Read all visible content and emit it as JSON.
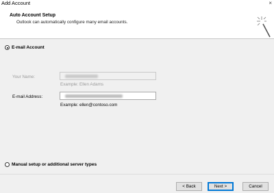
{
  "window": {
    "title": "Add Account",
    "close_glyph": "×"
  },
  "header": {
    "title": "Auto Account Setup",
    "subtitle": "Outlook can automatically configure many email accounts.",
    "icon": "magic-wand-icon"
  },
  "options": {
    "email_account": {
      "label": "E-mail Account",
      "selected": true
    },
    "manual_setup": {
      "label": "Manual setup or additional server types",
      "selected": false
    }
  },
  "form": {
    "your_name": {
      "label": "Your Name:",
      "value_obscured": true,
      "example": "Example: Ellen Adams",
      "enabled": false
    },
    "email_address": {
      "label": "E-mail Address:",
      "value_obscured": true,
      "example": "Example: ellen@contoso.com",
      "enabled": true
    }
  },
  "buttons": {
    "back": "< Back",
    "next": "Next >",
    "cancel": "Cancel"
  },
  "colors": {
    "default_button_border": "#0078d7",
    "header_bg": "#ffffff",
    "body_bg": "#f0f0f0"
  }
}
